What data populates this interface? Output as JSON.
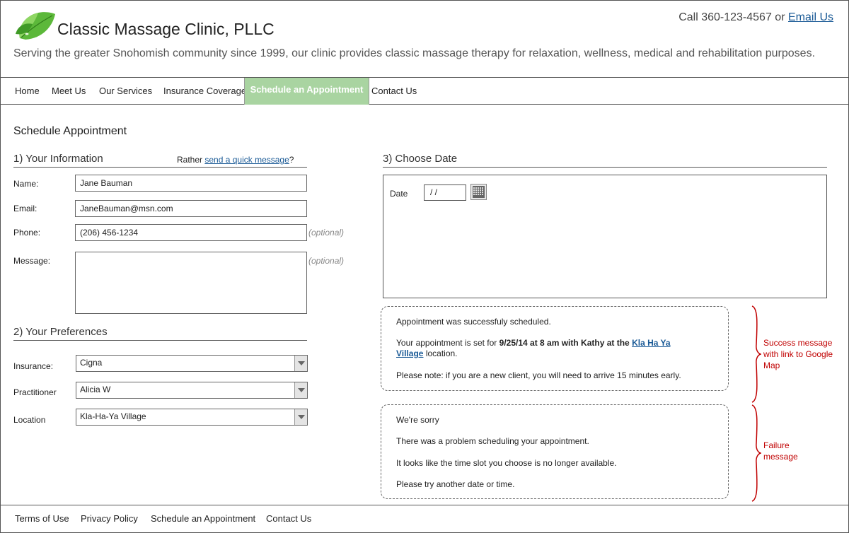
{
  "header": {
    "title": "Classic Massage Clinic, PLLC",
    "call_prefix": "Call 360-123-4567 or",
    "email_link": "Email Us",
    "tagline": "Serving the greater Snohomish community since 1999, our clinic provides classic massage therapy for relaxation, wellness, medical and rehabilitation purposes.",
    "logo_icon": "leaves-icon"
  },
  "nav": {
    "items": [
      "Home",
      "Meet Us",
      "Our Services",
      "Insurance Coverage",
      "Schedule an Appointment",
      "Contact Us"
    ],
    "active": "Schedule an Appointment",
    "active_color": "#a9d4a1"
  },
  "form": {
    "heading": "Schedule Appointment",
    "section1": "1) Your Information",
    "rather_prefix": "Rather",
    "rather_link": "send a quick message",
    "rather_suffix": "?",
    "name_label": "Name:",
    "name_value": "Jane Bauman",
    "email_label": "Email:",
    "email_value": "JaneBauman@msn.com",
    "phone_label": "Phone:",
    "phone_value": "(206) 456-1234",
    "phone_optional": "(optional)",
    "message_label": "Message:",
    "message_value": "",
    "message_optional": "(optional)",
    "section2": "2) Your Preferences",
    "insurance_label": "Insurance:",
    "insurance_value": "Cigna",
    "practitioner_label": "Practitioner",
    "practitioner_value": "Alicia W",
    "location_label": "Location",
    "location_value": "Kla-Ha-Ya Village"
  },
  "date": {
    "section3": "3) Choose Date",
    "label": "Date",
    "value": " /  /",
    "icon": "calendar-icon"
  },
  "success": {
    "line1": "Appointment was successfuly scheduled.",
    "line2_prefix": "Your appointment is set for",
    "line2_bold": "9/25/14 at 8 am with Kathy at the",
    "line2_link_a": "Kla Ha Ya",
    "line2_link_b": "Village",
    "line2_suffix": "location.",
    "line3": "Please note: if you are a new client, you will need to arrive 15 minutes early.",
    "annotation": [
      "Success message",
      "with link to Google",
      "Map"
    ]
  },
  "failure": {
    "line1": "We're sorry",
    "line2": "There was a problem scheduling your appointment.",
    "line3": "It looks like the time slot you choose is no longer available.",
    "line4": "Please try another date or time.",
    "annotation": [
      "Failure",
      "message"
    ]
  },
  "footer": {
    "links": [
      "Terms of Use",
      "Privacy Policy",
      "Schedule an Appointment",
      "Contact Us"
    ]
  },
  "colors": {
    "link": "#1a5a96",
    "annotation": "#c00000",
    "logo_green": "#5cb83a"
  }
}
